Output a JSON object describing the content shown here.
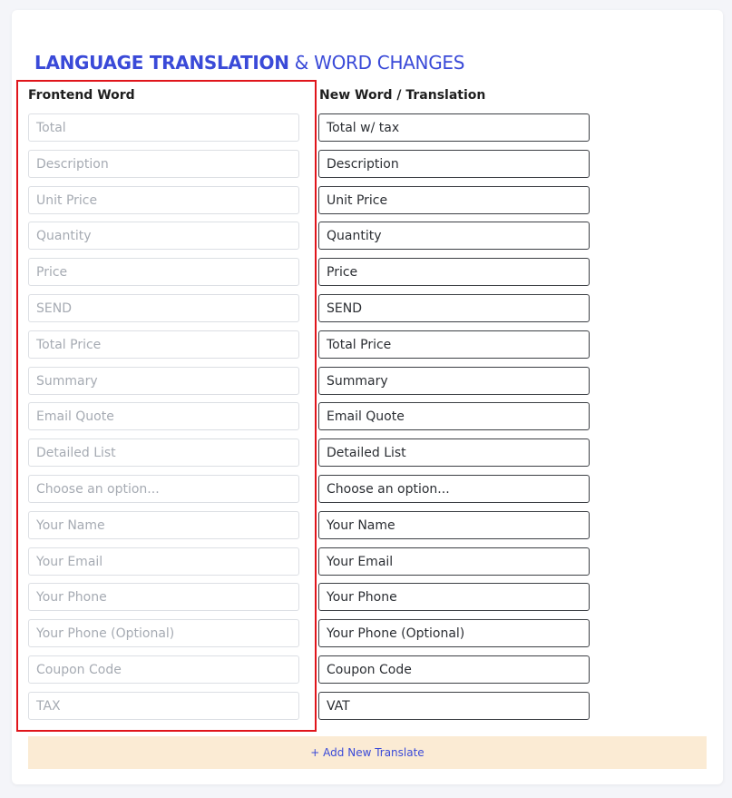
{
  "heading": {
    "bold": "LANGUAGE TRANSLATION",
    "rest": "& WORD CHANGES"
  },
  "columns": {
    "frontend": "Frontend Word",
    "translation": "New Word / Translation"
  },
  "rows": [
    {
      "frontend": "Total",
      "translation": "Total w/ tax"
    },
    {
      "frontend": "Description",
      "translation": "Description"
    },
    {
      "frontend": "Unit Price",
      "translation": "Unit Price"
    },
    {
      "frontend": "Quantity",
      "translation": "Quantity"
    },
    {
      "frontend": "Price",
      "translation": "Price"
    },
    {
      "frontend": "SEND",
      "translation": "SEND"
    },
    {
      "frontend": "Total Price",
      "translation": "Total Price"
    },
    {
      "frontend": "Summary",
      "translation": "Summary"
    },
    {
      "frontend": "Email Quote",
      "translation": "Email Quote"
    },
    {
      "frontend": "Detailed List",
      "translation": "Detailed List"
    },
    {
      "frontend": "Choose an option...",
      "translation": "Choose an option..."
    },
    {
      "frontend": "Your Name",
      "translation": "Your Name"
    },
    {
      "frontend": "Your Email",
      "translation": "Your Email"
    },
    {
      "frontend": "Your Phone",
      "translation": "Your Phone"
    },
    {
      "frontend": "Your Phone (Optional)",
      "translation": "Your Phone (Optional)"
    },
    {
      "frontend": "Coupon Code",
      "translation": "Coupon Code"
    },
    {
      "frontend": "TAX",
      "translation": "VAT"
    }
  ],
  "add_button": "+ Add New Translate",
  "colors": {
    "accent": "#3a4ad8",
    "highlight": "#e0151b",
    "add_bar_bg": "#fbebd4"
  }
}
